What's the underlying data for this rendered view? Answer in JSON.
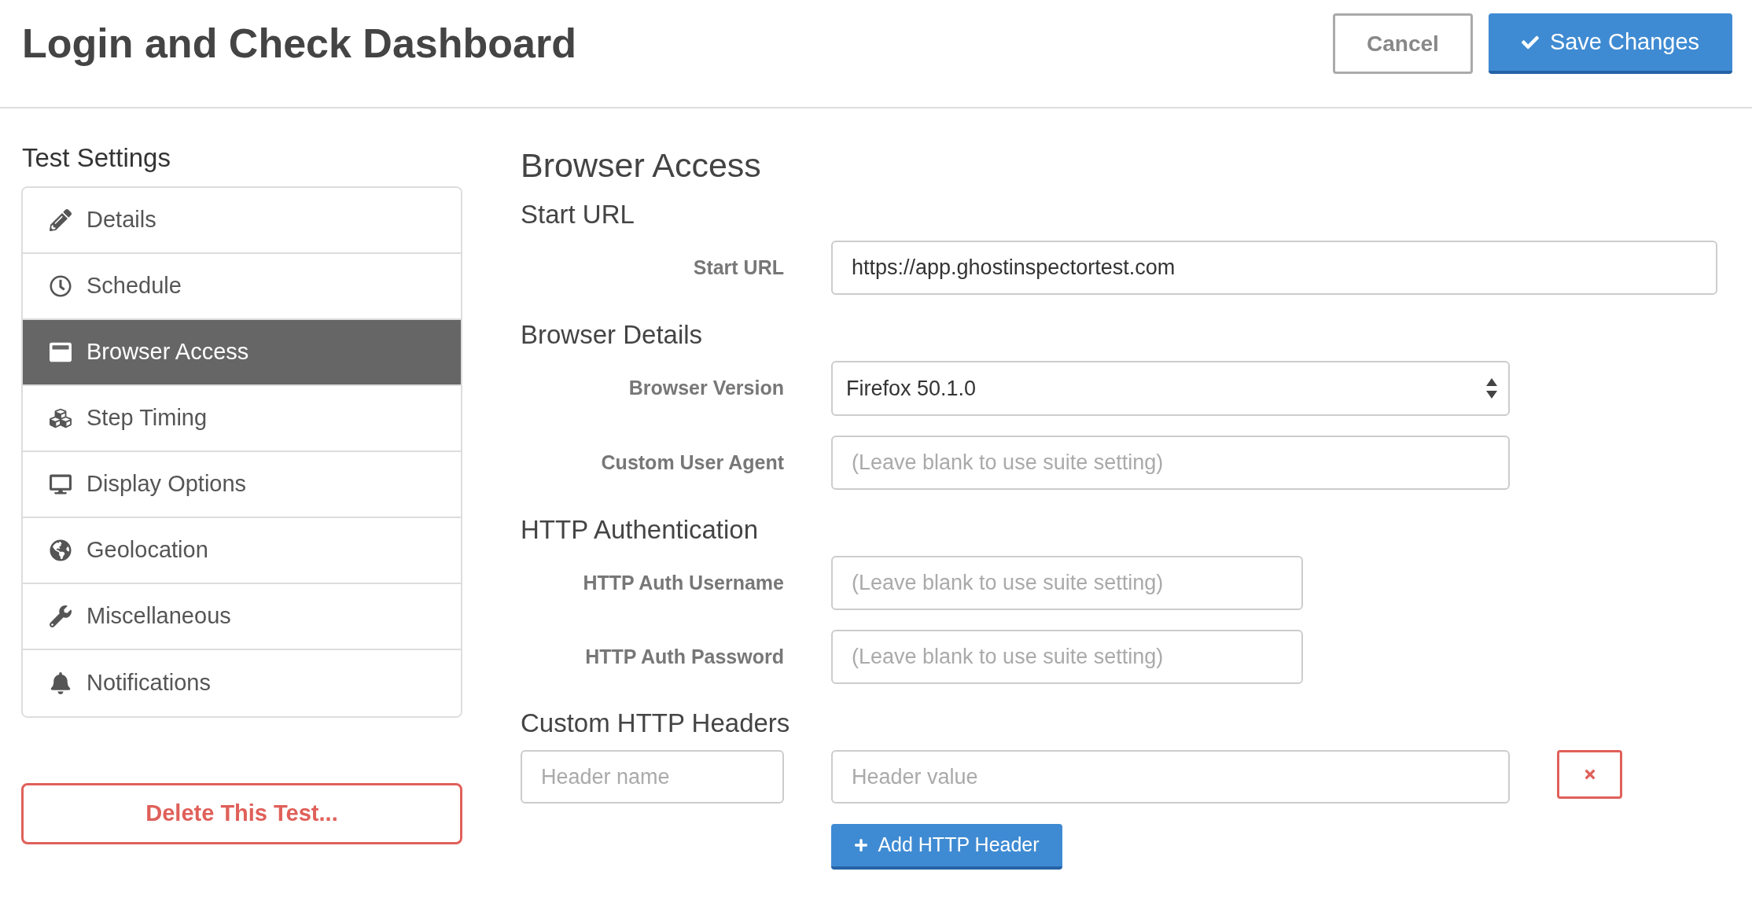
{
  "header": {
    "title": "Login and Check Dashboard",
    "buttons": [
      {
        "label": "Cancel",
        "kind": "secondary"
      },
      {
        "label": "Save Changes",
        "kind": "primary"
      }
    ]
  },
  "sidebar": {
    "title": "Test Settings",
    "items": [
      {
        "label": "Details",
        "selected": false
      },
      {
        "label": "Schedule",
        "selected": false
      },
      {
        "label": "Browser Access",
        "selected": true
      },
      {
        "label": "Step Timing",
        "selected": false
      },
      {
        "label": "Display Options",
        "selected": false
      },
      {
        "label": "Geolocation",
        "selected": false
      },
      {
        "label": "Miscellaneous",
        "selected": false
      },
      {
        "label": "Notifications",
        "selected": false
      }
    ],
    "delete_button": "Delete This Test..."
  },
  "main": {
    "title": "Browser Access",
    "sections": [
      {
        "title": "Start URL",
        "fields": [
          {
            "label": "Start URL",
            "kind": "text",
            "value": "https://app.ghostinspectortest.com"
          }
        ]
      },
      {
        "title": "Browser Details",
        "fields": [
          {
            "label": "Browser Version",
            "kind": "select",
            "value": "Firefox 50.1.0"
          },
          {
            "label": "Custom User Agent",
            "kind": "text",
            "placeholder": "(Leave blank to use suite setting)"
          }
        ]
      },
      {
        "title": "HTTP Authentication",
        "fields": [
          {
            "label": "HTTP Auth Username",
            "kind": "text",
            "placeholder": "(Leave blank to use suite setting)"
          },
          {
            "label": "HTTP Auth Password",
            "kind": "text",
            "placeholder": "(Leave blank to use suite setting)"
          }
        ]
      }
    ],
    "custom_headers": {
      "title": "Custom HTTP Headers",
      "rows": [
        {
          "name": {
            "placeholder": "Header name"
          },
          "value": {
            "placeholder": "Header value"
          }
        }
      ],
      "add_button": "Add HTTP Header"
    }
  }
}
